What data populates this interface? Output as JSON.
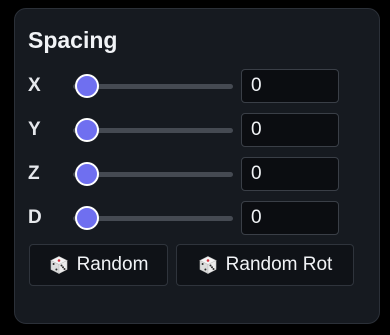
{
  "panel": {
    "title": "Spacing"
  },
  "rows": [
    {
      "label": "X",
      "value": "0",
      "slider_fraction": 0
    },
    {
      "label": "Y",
      "value": "0",
      "slider_fraction": 0
    },
    {
      "label": "Z",
      "value": "0",
      "slider_fraction": 0
    },
    {
      "label": "D",
      "value": "0",
      "slider_fraction": 0
    }
  ],
  "buttons": {
    "random_label": "Random",
    "random_rot_label": "Random Rot",
    "icon": "dice-icon"
  },
  "colors": {
    "accent": "#6f6ff0",
    "panel_bg": "#161a20",
    "input_bg": "#0b0d11",
    "text": "#f1f3f6"
  }
}
